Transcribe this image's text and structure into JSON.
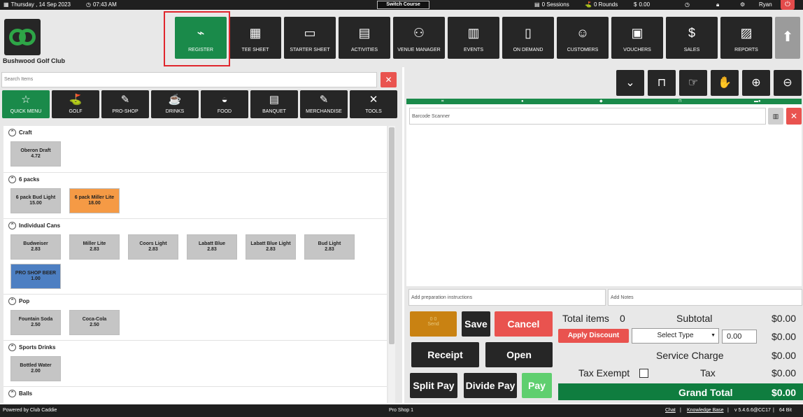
{
  "topbar": {
    "date": "Thursday , 14 Sep 2023",
    "time": "07:43 AM",
    "switch_course": "Switch Course",
    "sessions": "0 Sessions",
    "rounds": "0 Rounds",
    "balance": "0.00",
    "user": "Ryan"
  },
  "header": {
    "club_name": "Bushwood Golf Club",
    "nav": [
      {
        "label": "REGISTER",
        "icon": "barcode-scanner-icon",
        "glyph": "⌁"
      },
      {
        "label": "TEE SHEET",
        "icon": "tee-sheet-icon",
        "glyph": "▦"
      },
      {
        "label": "STARTER SHEET",
        "icon": "tablet-icon",
        "glyph": "▭"
      },
      {
        "label": "ACTIVITIES",
        "icon": "calendar-icon",
        "glyph": "▤"
      },
      {
        "label": "VENUE MANAGER",
        "icon": "people-icon",
        "glyph": "⚇"
      },
      {
        "label": "EVENTS",
        "icon": "events-icon",
        "glyph": "▥"
      },
      {
        "label": "ON DEMAND",
        "icon": "mobile-icon",
        "glyph": "▯"
      },
      {
        "label": "CUSTOMERS",
        "icon": "customers-icon",
        "glyph": "☺"
      },
      {
        "label": "VOUCHERS",
        "icon": "vouchers-icon",
        "glyph": "▣"
      },
      {
        "label": "SALES",
        "icon": "sales-icon",
        "glyph": "$"
      },
      {
        "label": "REPORTS",
        "icon": "reports-icon",
        "glyph": "▨"
      }
    ]
  },
  "search": {
    "placeholder": "Search Items"
  },
  "categories": [
    {
      "label": "QUICK MENU",
      "icon": "star-icon",
      "glyph": "☆"
    },
    {
      "label": "GOLF",
      "icon": "golf-icon",
      "glyph": "⛳"
    },
    {
      "label": "PRO-SHOP",
      "icon": "pro-shop-icon",
      "glyph": "✎"
    },
    {
      "label": "DRINKS",
      "icon": "drinks-icon",
      "glyph": "☕"
    },
    {
      "label": "FOOD",
      "icon": "food-icon",
      "glyph": "◒"
    },
    {
      "label": "BANQUET",
      "icon": "banquet-icon",
      "glyph": "▤"
    },
    {
      "label": "MERCHANDISE",
      "icon": "merchandise-icon",
      "glyph": "✎"
    },
    {
      "label": "TOOLS",
      "icon": "tools-icon",
      "glyph": "✕"
    }
  ],
  "sections": [
    {
      "name": "Craft",
      "items": [
        {
          "name": "Oberon Draft",
          "price": "4.72",
          "color": "#c5c5c5"
        }
      ]
    },
    {
      "name": "6 packs",
      "items": [
        {
          "name": "6 pack Bud Light",
          "price": "15.00",
          "color": "#c5c5c5"
        },
        {
          "name": "6 pack Miller Lite",
          "price": "18.00",
          "color": "#f59a45"
        }
      ]
    },
    {
      "name": "Individual Cans",
      "items": [
        {
          "name": "Budweiser",
          "price": "2.83",
          "color": "#c5c5c5"
        },
        {
          "name": "Miller Lite",
          "price": "2.83",
          "color": "#c5c5c5"
        },
        {
          "name": "Coors Light",
          "price": "2.83",
          "color": "#c5c5c5"
        },
        {
          "name": "Labatt Blue",
          "price": "2.83",
          "color": "#c5c5c5"
        },
        {
          "name": "Labatt Blue Light",
          "price": "2.83",
          "color": "#c5c5c5"
        },
        {
          "name": "Bud Light",
          "price": "2.83",
          "color": "#c5c5c5"
        },
        {
          "name": "PRO SHOP BEER",
          "price": "1.00",
          "color": "#4d7fc2"
        }
      ]
    },
    {
      "name": "Pop",
      "items": [
        {
          "name": "Fountain Soda",
          "price": "2.50",
          "color": "#c5c5c5"
        },
        {
          "name": "Coca-Cola",
          "price": "2.50",
          "color": "#c5c5c5"
        }
      ]
    },
    {
      "name": "Sports Drinks",
      "items": [
        {
          "name": "Bottled Water",
          "price": "2.00",
          "color": "#c5c5c5"
        }
      ]
    },
    {
      "name": "Balls",
      "items": []
    }
  ],
  "order": {
    "barcode_placeholder": "Barcode Scanner",
    "prep_placeholder": "Add preparation instructions",
    "notes_placeholder": "Add Notes"
  },
  "actions": {
    "send": "Send",
    "send_counts": "0   0",
    "save": "Save",
    "cancel": "Cancel",
    "receipt": "Receipt",
    "open": "Open",
    "split_pay": "Split Pay",
    "divide_pay": "Divide Pay",
    "pay": "Pay"
  },
  "totals": {
    "total_items_label": "Total items",
    "total_items": "0",
    "subtotal_label": "Subtotal",
    "subtotal": "$0.00",
    "apply_discount": "Apply Discount",
    "select_type": "Select Type",
    "discount_value": "0.00",
    "discount_amount": "$0.00",
    "service_charge_label": "Service Charge",
    "service_charge": "$0.00",
    "tax_exempt_label": "Tax Exempt",
    "tax_label": "Tax",
    "tax": "$0.00",
    "grand_total_label": "Grand Total",
    "grand_total": "$0.00"
  },
  "footer": {
    "powered": "Powered by Club Caddie",
    "terminal": "Pro Shop 1",
    "chat": "Chat",
    "kb": "Knowledge Base",
    "version": "v 5.4.6.6@CC17",
    "bits": "64 Bit"
  }
}
